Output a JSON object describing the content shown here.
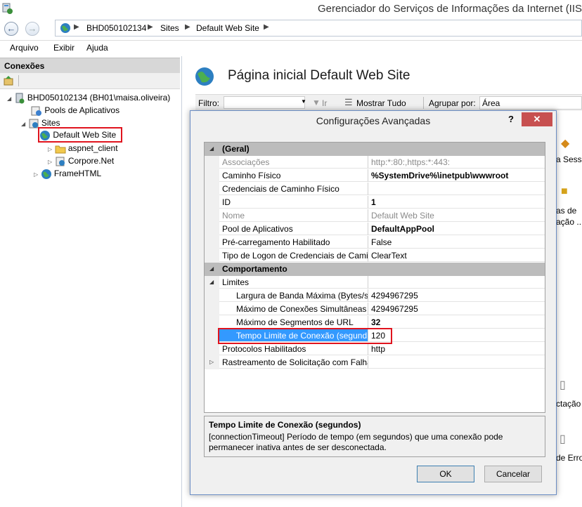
{
  "window": {
    "title": "Gerenciador do Serviços de Informações da Internet (IIS)"
  },
  "breadcrumb": [
    "BHD050102134",
    "Sites",
    "Default Web Site"
  ],
  "menu": [
    "Arquivo",
    "Exibir",
    "Ajuda"
  ],
  "connections": {
    "title": "Conexões",
    "tree": {
      "server": "BHD050102134 (BH01\\maisa.oliveira)",
      "app_pools": "Pools de Aplicativos",
      "sites": "Sites",
      "default_site": "Default Web Site",
      "aspnet_client": "aspnet_client",
      "corpore": "Corpore.Net",
      "framehtml": "FrameHTML"
    }
  },
  "home": {
    "title": "Página inicial Default Web Site",
    "filter_label": "Filtro:",
    "go_label": "Ir",
    "show_all_label": "Mostrar Tudo",
    "group_by_label": "Agrupar por:",
    "group_by_value": "Área",
    "partial_actions": [
      "a Sessã",
      "as de",
      "ação ..",
      "ctação",
      "de Erro"
    ]
  },
  "dialog": {
    "title": "Configurações Avançadas",
    "help": "?",
    "close": "✕",
    "rows": [
      {
        "name": "(Geral)",
        "value": ""
      },
      {
        "name": "Associações",
        "value": "http:*:80:,https:*:443:"
      },
      {
        "name": "Caminho Físico",
        "value": "%SystemDrive%\\inetpub\\wwwroot"
      },
      {
        "name": "Credenciais de Caminho Físico",
        "value": ""
      },
      {
        "name": "ID",
        "value": "1"
      },
      {
        "name": "Nome",
        "value": "Default Web Site"
      },
      {
        "name": "Pool de Aplicativos",
        "value": "DefaultAppPool"
      },
      {
        "name": "Pré-carregamento Habilitado",
        "value": "False"
      },
      {
        "name": "Tipo de Logon de Credenciais de Camin",
        "value": "ClearText"
      },
      {
        "name": "Comportamento",
        "value": ""
      },
      {
        "name": "Limites",
        "value": ""
      },
      {
        "name": "Largura de Banda Máxima (Bytes/se",
        "value": "4294967295"
      },
      {
        "name": "Máximo de Conexões Simultâneas",
        "value": "4294967295"
      },
      {
        "name": "Máximo de Segmentos de URL",
        "value": "32"
      },
      {
        "name": "Tempo Limite de Conexão (segund",
        "value": "120"
      },
      {
        "name": "Protocolos Habilitados",
        "value": "http"
      },
      {
        "name": "Rastreamento de Solicitação com Falha",
        "value": ""
      }
    ],
    "description": {
      "title": "Tempo Limite de Conexão (segundos)",
      "text": "[connectionTimeout] Período de tempo (em segundos) que uma conexão pode permanecer inativa antes de ser desconectada."
    },
    "ok_label": "OK",
    "cancel_label": "Cancelar"
  },
  "colors": {
    "selection": "#3399ff",
    "highlight": "#e0141e",
    "close": "#c75050"
  }
}
